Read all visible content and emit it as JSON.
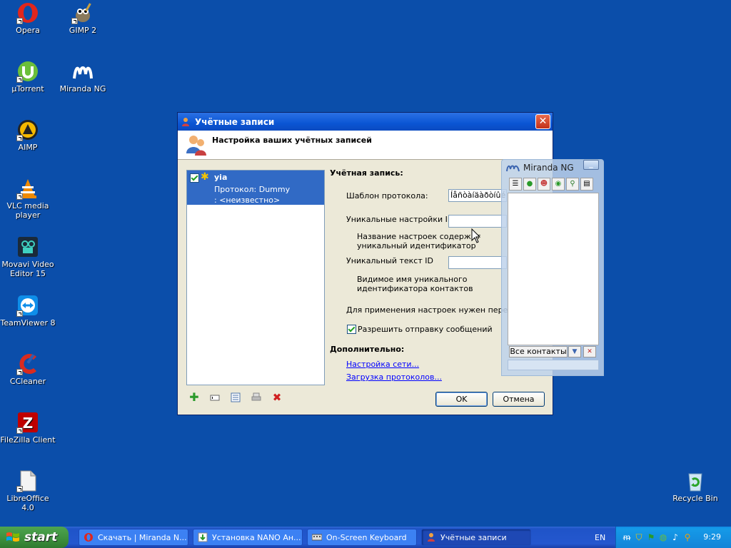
{
  "desktop": {
    "icons": [
      {
        "label": "Opera"
      },
      {
        "label": "GIMP 2"
      },
      {
        "label": "µTorrent"
      },
      {
        "label": "Miranda NG"
      },
      {
        "label": "AIMP"
      },
      {
        "label": "VLC media player"
      },
      {
        "label": "Movavi Video Editor 15"
      },
      {
        "label": "TeamViewer 8"
      },
      {
        "label": "CCleaner"
      },
      {
        "label": "FileZilla Client"
      },
      {
        "label": "LibreOffice 4.0"
      },
      {
        "label": "Recycle Bin"
      }
    ]
  },
  "dialog": {
    "title": "Учётные записи",
    "header": "Настройка ваших учётных записей",
    "account": {
      "name": "yia",
      "protocol": "Протокол: Dummy",
      "status": ": <неизвестно>"
    },
    "section_account": "Учётная запись:",
    "protocol_template_label": "Шаблон протокола:",
    "protocol_template_value": "Íåñòàíäàðòíûé",
    "unique_settings_label": "Уникальные настройки ID",
    "unique_settings_hint": "Название настроек содержит уникальный идентификатор контактов",
    "unique_text_label": "Уникальный текст ID",
    "unique_text_hint": "Видимое имя уникального идентификатора контактов",
    "restart_note": "Для применения настроек нужен перезапуск",
    "allow_messages_label": "Разрешить отправку сообщений",
    "section_advanced": "Дополнительно:",
    "network_link": "Настройка сети...",
    "load_protocols_link": "Загрузка протоколов...",
    "ok": "OK",
    "cancel": "Отмена"
  },
  "miranda": {
    "title": "Miranda NG",
    "all_contacts": "Все контакты"
  },
  "taskbar": {
    "start": "start",
    "tasks": [
      {
        "label": "Скачать | Miranda N..."
      },
      {
        "label": "Установка NANO Ан..."
      },
      {
        "label": "On-Screen Keyboard"
      },
      {
        "label": "Учётные записи"
      }
    ],
    "lang": "EN",
    "clock": "9:29"
  }
}
